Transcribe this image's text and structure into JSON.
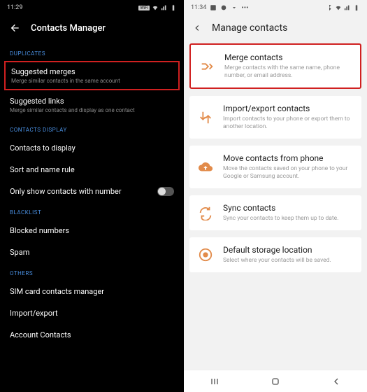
{
  "left": {
    "status": {
      "time": "11:29",
      "badge": "WiFi"
    },
    "header": {
      "title": "Contacts Manager"
    },
    "sections": {
      "duplicates": {
        "label": "DUPLICATES",
        "suggested_merges": {
          "title": "Suggested merges",
          "desc": "Merge similar contacts in the same account"
        },
        "suggested_links": {
          "title": "Suggested links",
          "desc": "Merge similar contacts and display as one contact"
        }
      },
      "display": {
        "label": "CONTACTS DISPLAY",
        "contacts_to_display": "Contacts to display",
        "sort_rule": "Sort and name rule",
        "only_number": "Only show contacts with number"
      },
      "blacklist": {
        "label": "BLACKLIST",
        "blocked": "Blocked numbers",
        "spam": "Spam"
      },
      "others": {
        "label": "OTHERS",
        "sim": "SIM card contacts manager",
        "import_export": "Import/export",
        "account": "Account Contacts"
      }
    }
  },
  "right": {
    "status": {
      "time": "11:34"
    },
    "header": {
      "title": "Manage contacts"
    },
    "cards": {
      "merge": {
        "title": "Merge contacts",
        "desc": "Merge contacts with the same name, phone number, or email address."
      },
      "import": {
        "title": "Import/export contacts",
        "desc": "Import contacts to your phone or export them to another location."
      },
      "move": {
        "title": "Move contacts from phone",
        "desc": "Move the contacts saved on your phone to your Google or Samsung account."
      },
      "sync": {
        "title": "Sync contacts",
        "desc": "Sync your contacts to keep them up to date."
      },
      "storage": {
        "title": "Default storage location",
        "desc": "Select where your contacts will be saved."
      }
    }
  }
}
